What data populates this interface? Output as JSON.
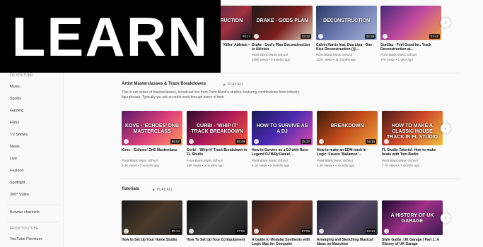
{
  "banner": {
    "text": "LEARN"
  },
  "sidebar": {
    "section_title": "of YouTube",
    "items": [
      "Music",
      "Sports",
      "Gaming",
      "Films",
      "TV Shows",
      "News",
      "Live",
      "Fashion",
      "Spotlight",
      "360° Video"
    ],
    "browse_channels": "Browse channels",
    "from_youtube_title": "FROM YOUTUBE",
    "from_youtube_items": [
      "YouTube Premium"
    ]
  },
  "top_row": {
    "videos": [
      {
        "thumb": "CONSTRUCTION",
        "duration": "08:14",
        "title": "'Killer' Ableton •",
        "channel": "",
        "meta": ""
      },
      {
        "thumb": "DRAKE - GODS PLAN",
        "duration": "13:12",
        "title": "Drake - God's Plan Deconstruction in Ableton",
        "channel": "Point Blank Music School",
        "meta": "168K views • 9 months ago"
      },
      {
        "thumb": "DECONSTRUCTION",
        "duration": "24:29",
        "title": "Calvin Harris feat. Dua Lipa - One Kiss Deconstruction (@...",
        "channel": "Point Blank Music School",
        "meta": "120K views • 11 months ago"
      },
      {
        "thumb": "",
        "duration": "21:42",
        "title": "Gorillaz - Feel Good Inc. Track Deconstruction at...",
        "channel": "Point Blank Music School",
        "meta": "37K views • 1 year ago"
      }
    ]
  },
  "shelf1": {
    "title": "Artist Masterclasses & Track Breakdowns",
    "play_all": "PLAY ALL",
    "description": "This is our series of masterclasses, broadcast live from Point Blank's studios, featuring contributions from industry figureheads. Typically we ask an artist work through some of their",
    "videos": [
      {
        "thumb": "KOVE - 'ECHOES' DNB MASTERCLASS",
        "duration": "56:57",
        "title": "Kove - 'Echoes' DnB Masterclass",
        "channel": "Point Blank Music School",
        "meta": "5.3K views • 3 months ago"
      },
      {
        "thumb": "CURBI - 'WHIP IT' TRACK BREAKDOWN",
        "duration": "45:49",
        "title": "Curbi - 'Whip It' Track Breakdown in FL Studio",
        "channel": "Point Blank Music School",
        "meta": "48K views • 3 months ago"
      },
      {
        "thumb": "HOW TO SURVIVE AS A DJ",
        "duration": "25:37",
        "title": "How to Survive as a DJ with Rave Legend DJ Billy Daniel...",
        "channel": "Point Blank Music School",
        "meta": "6.1K views • 5 months ago"
      },
      {
        "thumb": "BREAKDOWN",
        "duration": "18:16",
        "title": "How to make an EDM track in Logic: Fausto 'Bailamos'...",
        "channel": "Point Blank Music School",
        "meta": "3.4K views • 4 months ago"
      },
      {
        "thumb": "HOW TO MAKE A CLASSIC HOUSE TRACK IN FL STUDIO",
        "duration": "",
        "title": "FL Studio Tutorial: How to make beats with Tom Budin",
        "channel": "Point Blank Music School",
        "meta": "7.7K views • 7 months ago"
      }
    ]
  },
  "shelf2": {
    "title": "Tutorials",
    "play_all": "PLAY ALL",
    "videos": [
      {
        "thumb": "",
        "duration": "05:14",
        "title": "How to Set Up Your Home Studio"
      },
      {
        "thumb": "",
        "duration": "17:02",
        "title": "How To Set Up Your DJ Equipment"
      },
      {
        "thumb": "",
        "duration": "27:55",
        "title": "A Guide to Modular Synthesis with Logic Mac for Computer"
      },
      {
        "thumb": "",
        "duration": "24:13",
        "title": "Arranging and Sketching Musical Ideas on Maschine"
      },
      {
        "thumb": "A HISTORY OF UK GARAGE",
        "duration": "",
        "title": "Style Guide: UK Garage | Part 1: A History of UK Garage"
      }
    ]
  },
  "colors": {
    "banner_bg": "#000000",
    "banner_text": "#ffffff"
  },
  "icons": {
    "next": "chevron-right-icon"
  }
}
